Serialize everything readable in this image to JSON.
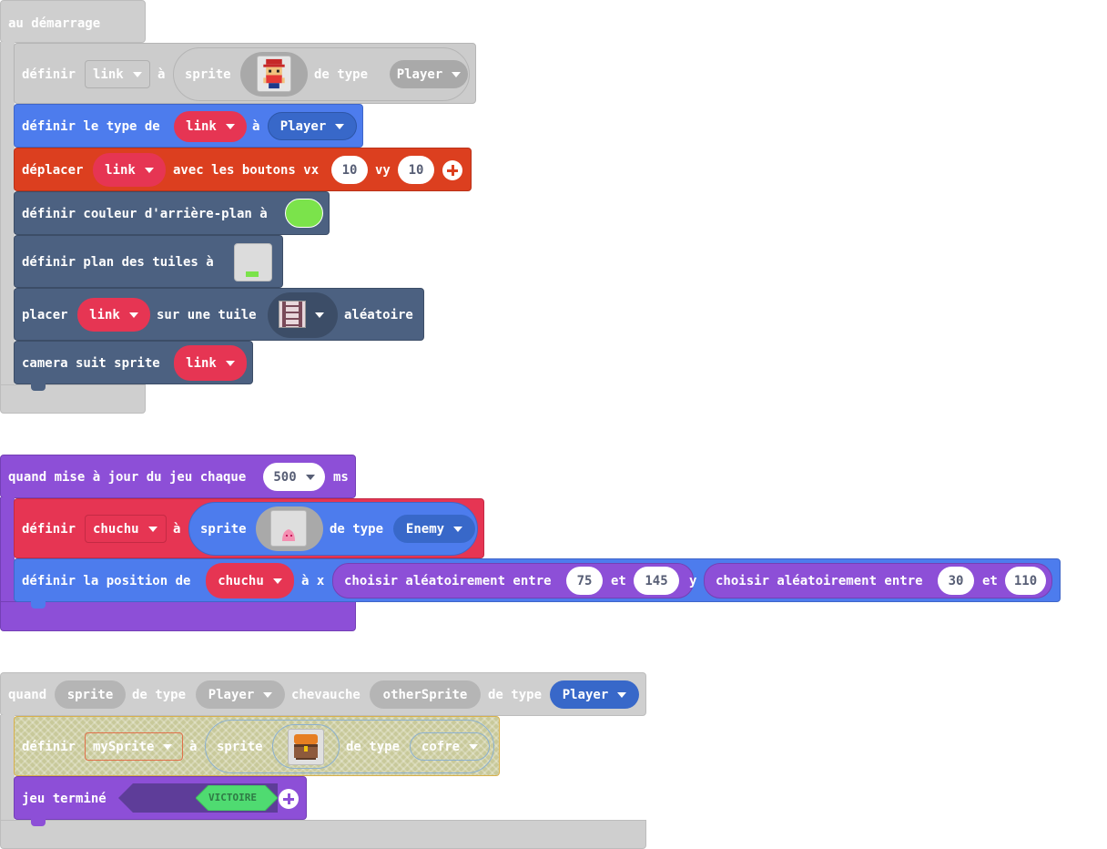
{
  "colors": {
    "gray_event": "#cfcfcf",
    "gray_block": "#cccccc",
    "blue": "#4d7ced",
    "red_orange": "#dc3f1f",
    "slate": "#4c6181",
    "purple": "#8d4fd7",
    "red": "#e63553",
    "player_blue": "#3868c9",
    "green_color": "#7be34b",
    "victoire_green": "#4fdb71"
  },
  "onstart": {
    "label": "au démarrage",
    "set_sprite": {
      "prefix": "définir",
      "var": "link",
      "to": "à",
      "sprite_label": "sprite",
      "image_icon": "hero-sprite-icon",
      "of_type": "de type",
      "kind": "Player"
    },
    "set_kind": {
      "prefix": "définir le type de",
      "var": "link",
      "to": "à",
      "kind": "Player"
    },
    "move": {
      "prefix": "déplacer",
      "var": "link",
      "buttons": "avec les boutons vx",
      "vx": "10",
      "vy_label": "vy",
      "vy": "10",
      "plus_icon": "plus-icon"
    },
    "bgcolor": {
      "label": "définir couleur d'arrière-plan à",
      "swatch": "green"
    },
    "tilemap": {
      "label": "définir plan des tuiles à",
      "image_icon": "tilemap-icon"
    },
    "place": {
      "prefix": "placer",
      "var": "link",
      "middle": "sur une tuile",
      "tile_icon": "ladder-tile-icon",
      "suffix": "aléatoire"
    },
    "camera": {
      "label": "camera suit sprite",
      "var": "link"
    }
  },
  "update": {
    "label": "quand mise à jour du jeu chaque",
    "interval": "500",
    "unit": "ms",
    "set_sprite": {
      "prefix": "définir",
      "var": "chuchu",
      "to": "à",
      "sprite_label": "sprite",
      "image_icon": "pink-blob-sprite-icon",
      "of_type": "de type",
      "kind": "Enemy"
    },
    "set_pos": {
      "prefix": "définir la position de",
      "var": "chuchu",
      "x_label": "à x",
      "rand1_label": "choisir aléatoirement entre",
      "rand1_min": "75",
      "rand1_and": "et",
      "rand1_max": "145",
      "y_label": "y",
      "rand2_label": "choisir aléatoirement entre",
      "rand2_min": "30",
      "rand2_and": "et",
      "rand2_max": "110"
    }
  },
  "overlap": {
    "quand": "quand",
    "sprite": "sprite",
    "of_type1": "de type",
    "kind1": "Player",
    "chevauche": "chevauche",
    "other": "otherSprite",
    "of_type2": "de type",
    "kind2": "Player",
    "set_sprite": {
      "prefix": "définir",
      "var": "mySprite",
      "to": "à",
      "sprite_label": "sprite",
      "image_icon": "chest-sprite-icon",
      "of_type": "de type",
      "kind": "cofre"
    },
    "game_over": {
      "label": "jeu terminé",
      "effect": "VICTOIRE",
      "plus_icon": "plus-icon"
    }
  }
}
